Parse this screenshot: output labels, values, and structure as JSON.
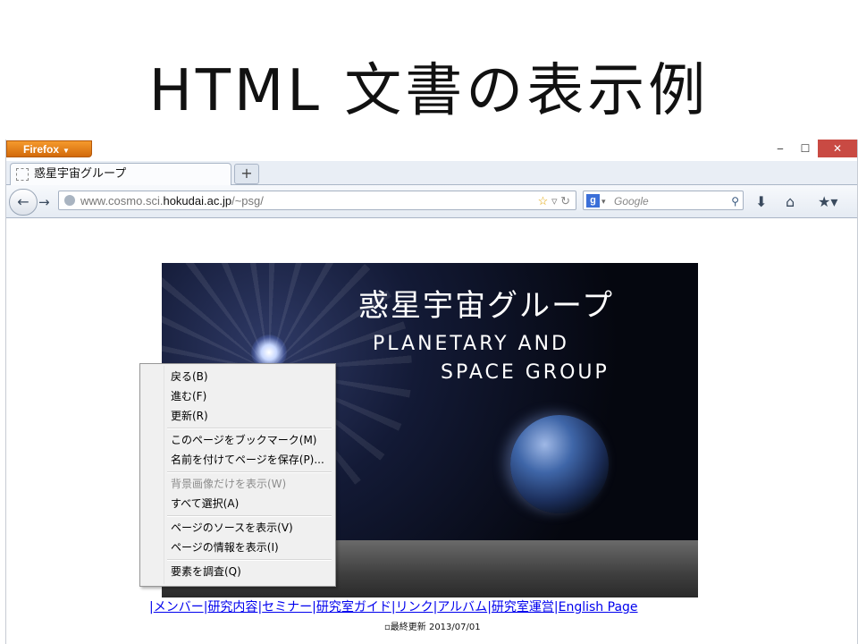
{
  "slide": {
    "title": "HTML 文書の表示例"
  },
  "window": {
    "app_button": "Firefox",
    "min": "‒",
    "max": "☐",
    "close": "✕"
  },
  "tab": {
    "title": "惑星宇宙グループ",
    "new_tab": "+"
  },
  "nav": {
    "back": "←",
    "forward": "→",
    "url_prefix": "www.cosmo.sci.",
    "url_host": "hokudai.ac.jp",
    "url_path": "/~psg/",
    "search_placeholder": "Google",
    "download": "⬇",
    "home": "⌂",
    "bookmarks": "★▾"
  },
  "banner": {
    "title_jp": "惑星宇宙グループ",
    "title_en_1": "PLANETARY AND",
    "title_en_2": "SPACE GROUP"
  },
  "context_menu": [
    {
      "label": "戻る(B)",
      "enabled": true
    },
    {
      "label": "進む(F)",
      "enabled": true
    },
    {
      "label": "更新(R)",
      "enabled": true
    },
    {
      "label": "このページをブックマーク(M)",
      "enabled": true
    },
    {
      "label": "名前を付けてページを保存(P)...",
      "enabled": true
    },
    {
      "label": "背景画像だけを表示(W)",
      "enabled": false
    },
    {
      "label": "すべて選択(A)",
      "enabled": true
    },
    {
      "label": "ページのソースを表示(V)",
      "enabled": true
    },
    {
      "label": "ページの情報を表示(I)",
      "enabled": true
    },
    {
      "label": "要素を調査(Q)",
      "enabled": true
    }
  ],
  "links": [
    "メンバー",
    "研究内容",
    "セミナー",
    "研究室ガイド",
    "リンク",
    "アルバム",
    "研究室運営",
    "English Page"
  ],
  "footer": {
    "updated": "最終更新 2013/07/01"
  }
}
